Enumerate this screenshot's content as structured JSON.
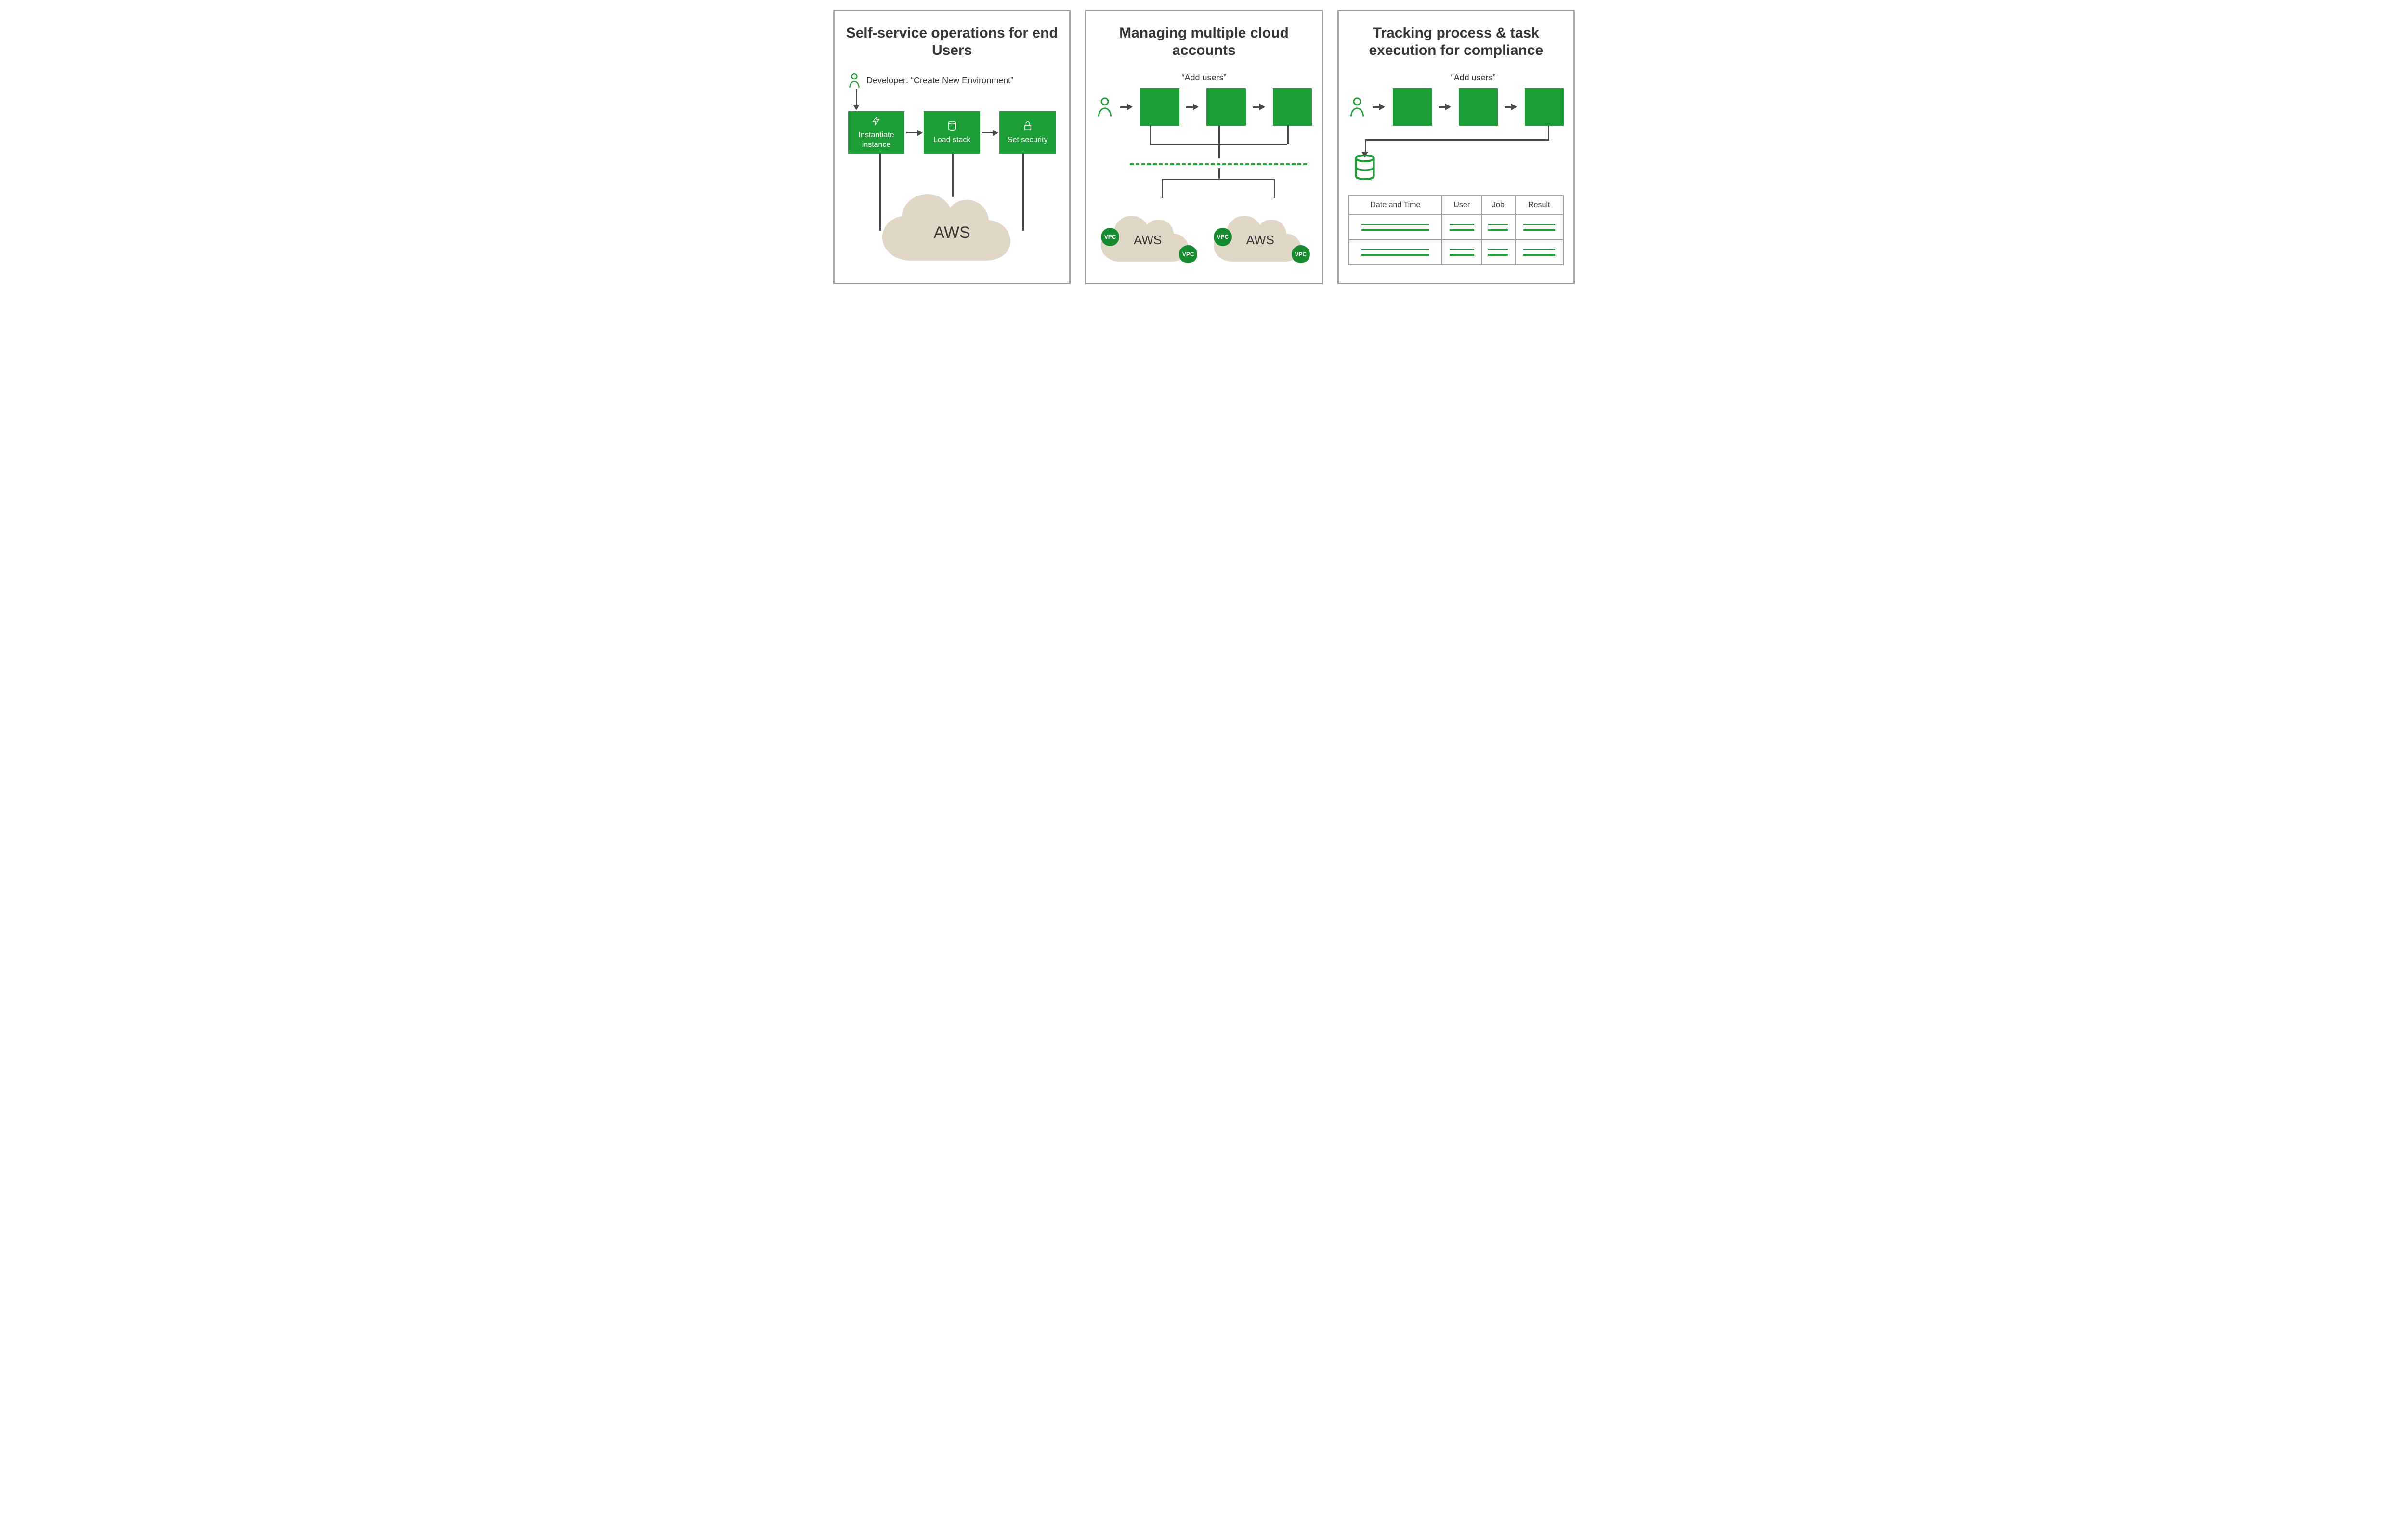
{
  "panels": [
    {
      "title": "Self-service operations for end Users",
      "actor_label": "Developer: “Create New Environment”",
      "steps": [
        "Instantiate instance",
        "Load stack",
        "Set security"
      ],
      "cloud_label": "AWS"
    },
    {
      "title": "Managing multiple cloud accounts",
      "caption": "“Add users”",
      "cloud_label": "AWS",
      "vpc_label": "VPC"
    },
    {
      "title": "Tracking process & task execution for compliance",
      "caption": "“Add users”",
      "table_headers": [
        "Date and Time",
        "User",
        "Job",
        "Result"
      ]
    }
  ]
}
